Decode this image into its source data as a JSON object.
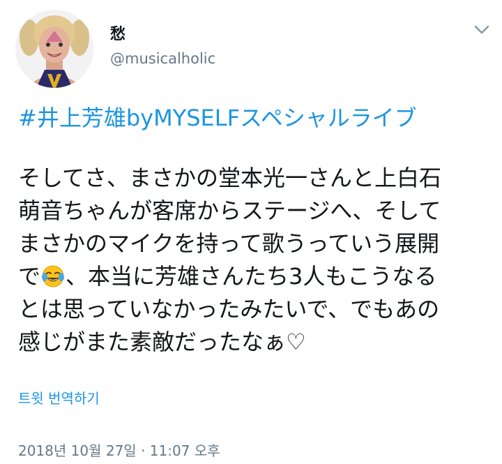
{
  "user": {
    "display_name": "愁",
    "handle": "@musicalholic"
  },
  "menu": {
    "icon": "chevron-down-icon"
  },
  "tweet": {
    "hashtag": "#井上芳雄byMYSELFスペシャルライブ",
    "lines": [
      "そしてさ、まさかの堂本光一さんと上白石",
      "萌音ちゃんが客席からステージへ、そして",
      "まさかのマイクを持って歌うっていう展開",
      "、本当に芳雄さんたち3人もこうなる",
      "とは思っていなかったみたいで、でもあの",
      "感じがまた素敵だったなぁ♡"
    ],
    "line4_prefix": "で",
    "emoji": "face-with-tears-of-joy-icon"
  },
  "translate_label": "트윗 번역하기",
  "timestamp": "2018년 10월 27일 · 11:07 오후",
  "colors": {
    "link": "#1b95e0",
    "secondary": "#657786",
    "text": "#14171a"
  }
}
